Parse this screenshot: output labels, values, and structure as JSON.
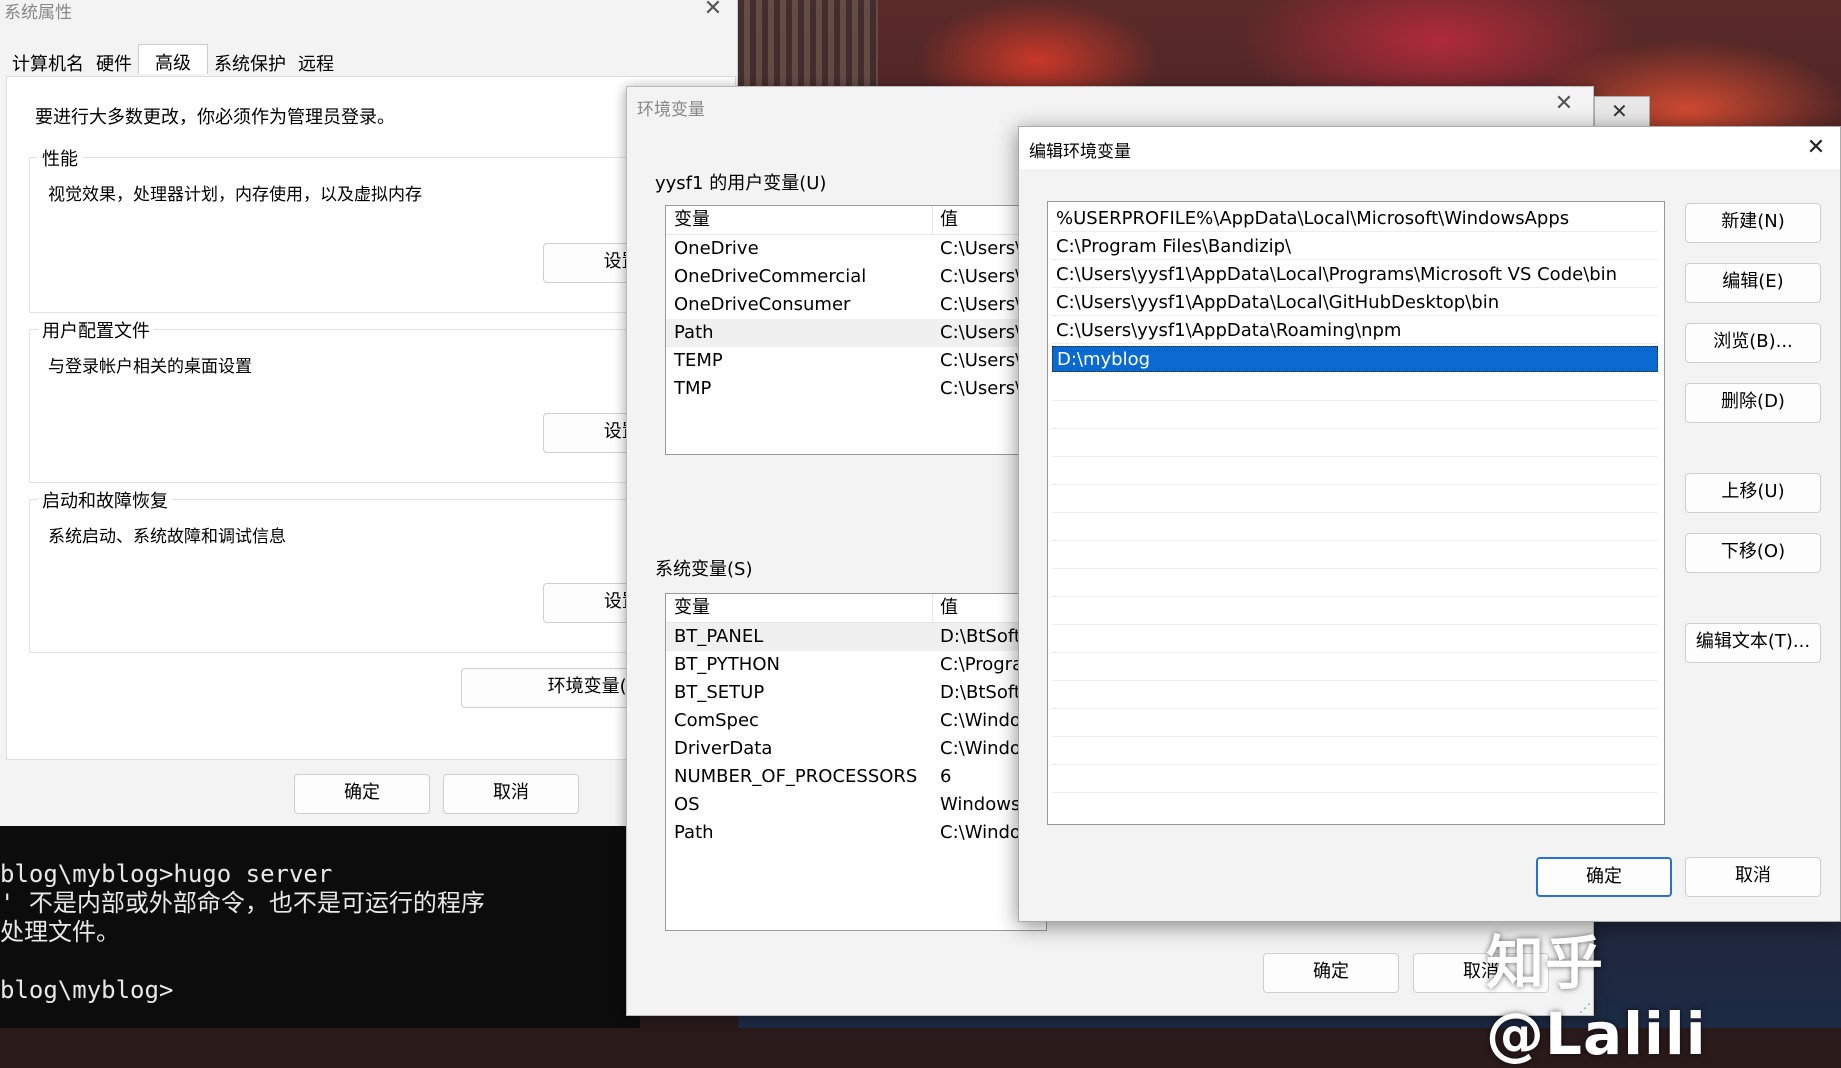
{
  "sysprop": {
    "title": "系统属性",
    "tabs": [
      "计算机名",
      "硬件",
      "高级",
      "系统保护",
      "远程"
    ],
    "admin_note": "要进行大多数更改，你必须作为管理员登录。",
    "performance": {
      "label": "性能",
      "desc": "视觉效果，处理器计划，内存使用，以及虚拟内存",
      "button": "设置(S)..."
    },
    "profile": {
      "label": "用户配置文件",
      "desc": "与登录帐户相关的桌面设置",
      "button": "设置(E)..."
    },
    "startup": {
      "label": "启动和故障恢复",
      "desc": "系统启动、系统故障和调试信息",
      "button": "设置(T)..."
    },
    "env_button": "环境变量(N)...",
    "ok": "确定",
    "cancel": "取消"
  },
  "envwin": {
    "title": "环境变量",
    "user_section": "yysf1 的用户变量(U)",
    "user_header": {
      "var": "变量",
      "val": "值"
    },
    "user_rows": [
      {
        "var": "OneDrive",
        "val": "C:\\Users\\"
      },
      {
        "var": "OneDriveCommercial",
        "val": "C:\\Users\\"
      },
      {
        "var": "OneDriveConsumer",
        "val": "C:\\Users\\"
      },
      {
        "var": "Path",
        "val": "C:\\Users\\"
      },
      {
        "var": "TEMP",
        "val": "C:\\Users\\"
      },
      {
        "var": "TMP",
        "val": "C:\\Users\\"
      }
    ],
    "sys_section": "系统变量(S)",
    "sys_header": {
      "var": "变量",
      "val": "值"
    },
    "sys_rows": [
      {
        "var": "BT_PANEL",
        "val": "D:\\BtSoft"
      },
      {
        "var": "BT_PYTHON",
        "val": "C:\\Progra"
      },
      {
        "var": "BT_SETUP",
        "val": "D:\\BtSoft"
      },
      {
        "var": "ComSpec",
        "val": "C:\\Windo"
      },
      {
        "var": "DriverData",
        "val": "C:\\Windo"
      },
      {
        "var": "NUMBER_OF_PROCESSORS",
        "val": "6"
      },
      {
        "var": "OS",
        "val": "Windows"
      },
      {
        "var": "Path",
        "val": "C:\\Windo"
      }
    ],
    "ok": "确定",
    "cancel": "取消"
  },
  "editwin": {
    "title": "编辑环境变量",
    "paths": [
      "%USERPROFILE%\\AppData\\Local\\Microsoft\\WindowsApps",
      "C:\\Program Files\\Bandizip\\",
      "C:\\Users\\yysf1\\AppData\\Local\\Programs\\Microsoft VS Code\\bin",
      "C:\\Users\\yysf1\\AppData\\Local\\GitHubDesktop\\bin",
      "C:\\Users\\yysf1\\AppData\\Roaming\\npm",
      "D:\\myblog"
    ],
    "selected_index": 5,
    "buttons": {
      "new": "新建(N)",
      "edit": "编辑(E)",
      "browse": "浏览(B)...",
      "delete": "删除(D)",
      "up": "上移(U)",
      "down": "下移(O)",
      "edit_text": "编辑文本(T)..."
    },
    "ok": "确定",
    "cancel": "取消"
  },
  "terminal": {
    "lines": [
      "blog\\myblog>hugo server",
      "' 不是内部或外部命令，也不是可运行的程序",
      "处理文件。",
      "",
      "blog\\myblog>"
    ]
  },
  "watermark": "知乎 @Lalili",
  "colors": {
    "selection": "#0a6ad2",
    "primary_border": "#2a6fd6",
    "terminal_bg": "#0c0c0c"
  }
}
